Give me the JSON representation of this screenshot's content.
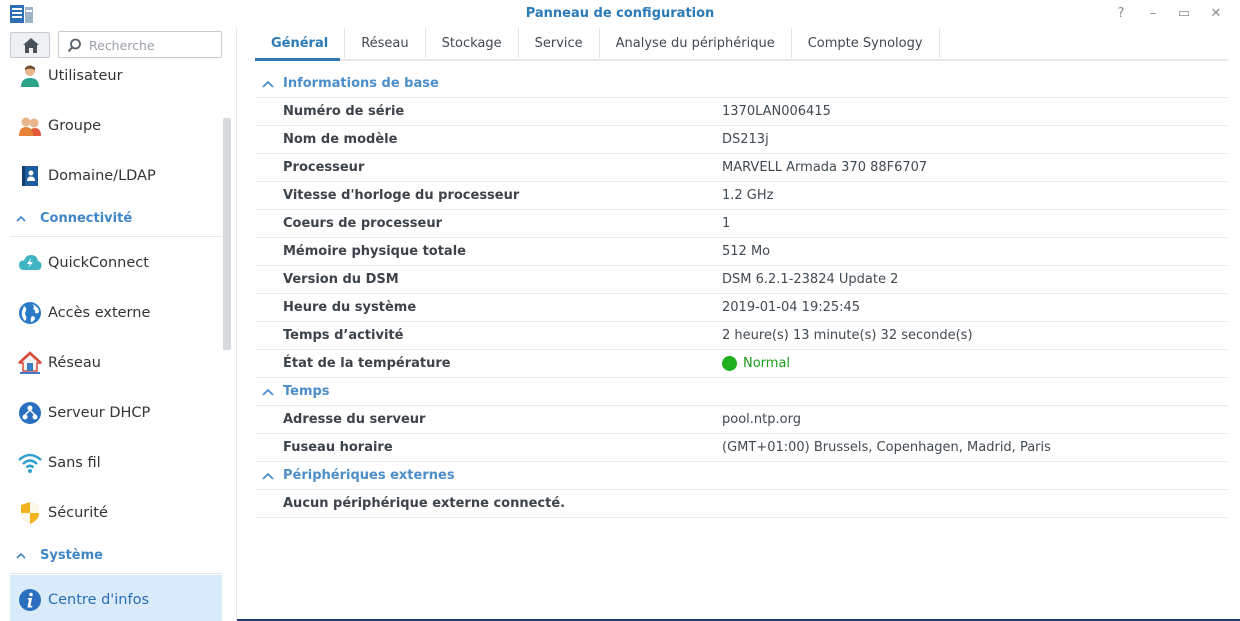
{
  "window": {
    "title": "Panneau de configuration",
    "controls": [
      "?",
      "–",
      "▭",
      "✕"
    ]
  },
  "sidebar": {
    "search_placeholder": "Recherche",
    "items": [
      {
        "label": "Utilisateur",
        "icon": "user-icon"
      },
      {
        "label": "Groupe",
        "icon": "group-icon"
      },
      {
        "label": "Domaine/LDAP",
        "icon": "directory-icon"
      }
    ],
    "section_connectivity": "Connectivité",
    "connectivity_items": [
      {
        "label": "QuickConnect",
        "icon": "quickconnect-cloud-icon"
      },
      {
        "label": "Accès externe",
        "icon": "globe-icon"
      },
      {
        "label": "Réseau",
        "icon": "network-house-icon"
      },
      {
        "label": "Serveur DHCP",
        "icon": "dhcp-icon"
      },
      {
        "label": "Sans fil",
        "icon": "wifi-icon"
      },
      {
        "label": "Sécurité",
        "icon": "shield-icon"
      }
    ],
    "section_system": "Système",
    "system_items": [
      {
        "label": "Centre d'infos",
        "icon": "info-icon",
        "active": true
      }
    ]
  },
  "tabs": [
    {
      "label": "Général",
      "active": true
    },
    {
      "label": "Réseau"
    },
    {
      "label": "Stockage"
    },
    {
      "label": "Service"
    },
    {
      "label": "Analyse du périphérique"
    },
    {
      "label": "Compte Synology"
    }
  ],
  "groups": {
    "basic": {
      "title": "Informations de base",
      "rows": [
        {
          "key": "Numéro de série",
          "value": "1370LAN006415"
        },
        {
          "key": "Nom de modèle",
          "value": "DS213j"
        },
        {
          "key": "Processeur",
          "value": "MARVELL Armada 370 88F6707"
        },
        {
          "key": "Vitesse d'horloge du processeur",
          "value": "1.2 GHz"
        },
        {
          "key": "Coeurs de processeur",
          "value": "1"
        },
        {
          "key": "Mémoire physique totale",
          "value": "512 Mo"
        },
        {
          "key": "Version du DSM",
          "value": "DSM 6.2.1-23824 Update 2"
        },
        {
          "key": "Heure du système",
          "value": "2019-01-04 19:25:45"
        },
        {
          "key": "Temps d’activité",
          "value": "2 heure(s) 13 minute(s) 32 seconde(s)"
        },
        {
          "key": "État de la température",
          "value": "Normal"
        }
      ]
    },
    "time": {
      "title": "Temps",
      "rows": [
        {
          "key": "Adresse du serveur",
          "value": "pool.ntp.org"
        },
        {
          "key": "Fuseau horaire",
          "value": "(GMT+01:00) Brussels, Copenhagen, Madrid, Paris"
        }
      ]
    },
    "external": {
      "title": "Périphériques externes",
      "rows": [
        {
          "key": "Aucun périphérique externe connecté.",
          "value": ""
        }
      ]
    }
  },
  "colors": {
    "accent": "#2a7ab8",
    "section": "#4c8ec9",
    "status_ok": "#1fb01f",
    "active_bg": "#d9ebfa"
  }
}
